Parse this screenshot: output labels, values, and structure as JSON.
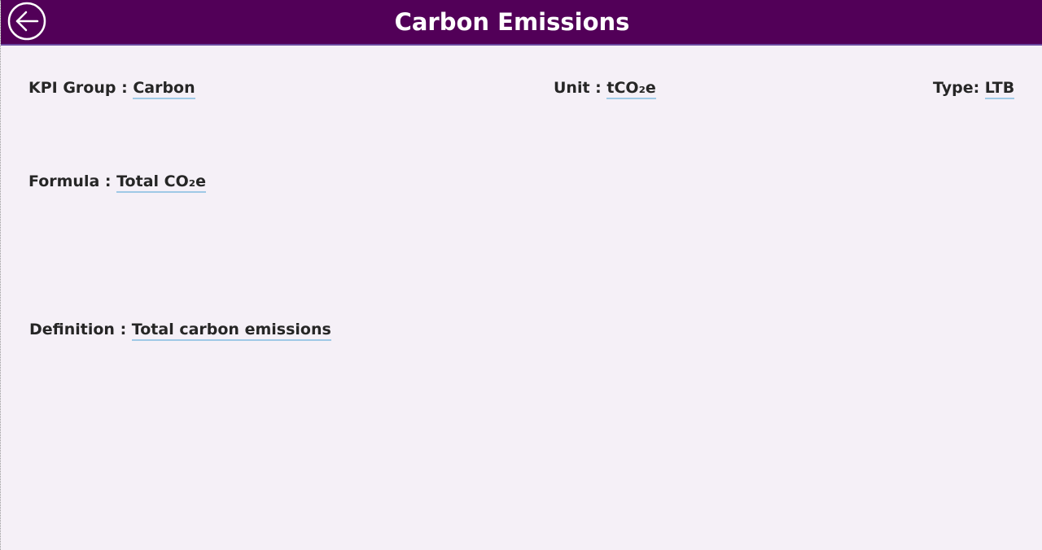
{
  "header": {
    "title": "Carbon Emissions",
    "back_icon": "arrow-left-circle-icon",
    "background_color": "#520058",
    "text_color": "#ffffff"
  },
  "details": {
    "kpi_group_label": "KPI Group : ",
    "kpi_group_value": "Carbon",
    "unit_label": "Unit : ",
    "unit_value": "tCO₂e",
    "type_label": "Type: ",
    "type_value": "LTB",
    "formula_label": "Formula : ",
    "formula_value": "Total CO₂e",
    "definition_label": "Definition : ",
    "definition_value": "Total carbon emissions"
  },
  "colors": {
    "page_background": "#f5f0f7",
    "value_underline": "#9fc9e6"
  }
}
